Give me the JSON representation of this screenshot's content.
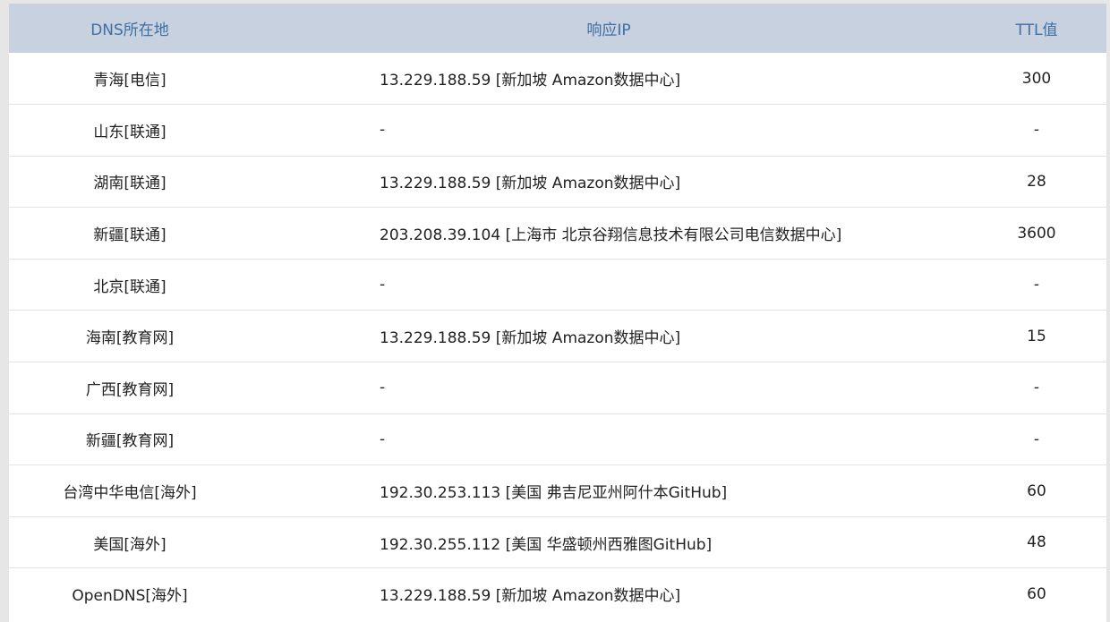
{
  "table": {
    "headers": {
      "location": "DNS所在地",
      "ip": "响应IP",
      "ttl": "TTL值"
    },
    "rows": [
      {
        "location": "青海[电信]",
        "ip": "13.229.188.59 [新加坡 Amazon数据中心]",
        "ttl": "300"
      },
      {
        "location": "山东[联通]",
        "ip": "-",
        "ttl": "-"
      },
      {
        "location": "湖南[联通]",
        "ip": "13.229.188.59 [新加坡 Amazon数据中心]",
        "ttl": "28"
      },
      {
        "location": "新疆[联通]",
        "ip": "203.208.39.104 [上海市 北京谷翔信息技术有限公司电信数据中心]",
        "ttl": "3600"
      },
      {
        "location": "北京[联通]",
        "ip": "-",
        "ttl": "-"
      },
      {
        "location": "海南[教育网]",
        "ip": "13.229.188.59 [新加坡 Amazon数据中心]",
        "ttl": "15"
      },
      {
        "location": "广西[教育网]",
        "ip": "-",
        "ttl": "-"
      },
      {
        "location": "新疆[教育网]",
        "ip": "-",
        "ttl": "-"
      },
      {
        "location": "台湾中华电信[海外]",
        "ip": "192.30.253.113 [美国 弗吉尼亚州阿什本GitHub]",
        "ttl": "60"
      },
      {
        "location": "美国[海外]",
        "ip": "192.30.255.112 [美国 华盛顿州西雅图GitHub]",
        "ttl": "48"
      },
      {
        "location": "OpenDNS[海外]",
        "ip": "13.229.188.59 [新加坡 Amazon数据中心]",
        "ttl": "60"
      }
    ]
  },
  "colors": {
    "header_bg": "#c7d1e0",
    "header_text": "#3f6fa3",
    "row_divider": "#e3e3e3",
    "page_bg": "#e6e6e6"
  }
}
